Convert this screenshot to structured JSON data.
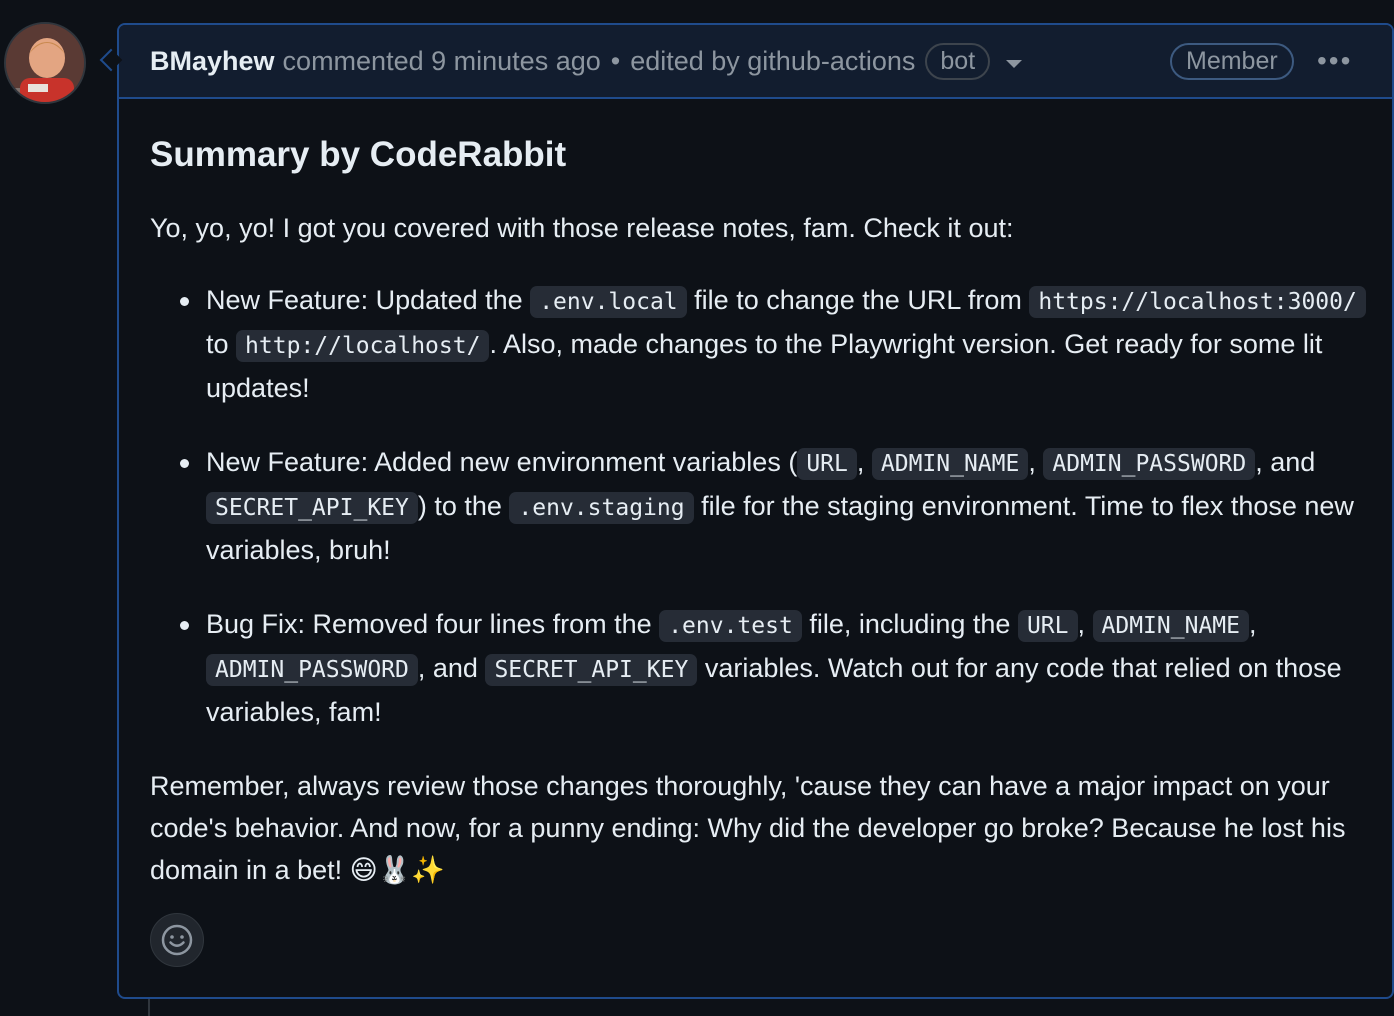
{
  "comment": {
    "author": "BMayhew",
    "action": "commented",
    "time": "9 minutes ago",
    "separator": "•",
    "edited": "edited by github-actions",
    "bot_badge": "bot",
    "member_badge": "Member",
    "more": "•••"
  },
  "body": {
    "title": "Summary by CodeRabbit",
    "intro": "Yo, yo, yo! I got you covered with those release notes, fam. Check it out:",
    "b1": {
      "t1": "New Feature: Updated the ",
      "c1": ".env.local",
      "t2": " file to change the URL from ",
      "c2": "https://localhost:3000/",
      "t3": " to ",
      "c3": "http://localhost/",
      "t4": ". Also, made changes to the Playwright version. Get ready for some lit updates!"
    },
    "b2": {
      "t1": "New Feature: Added new environment variables (",
      "c1": "URL",
      "t2": ", ",
      "c2": "ADMIN_NAME",
      "t3": ", ",
      "c3": "ADMIN_PASSWORD",
      "t4": ", and ",
      "c4": "SECRET_API_KEY",
      "t5": ") to the ",
      "c5": ".env.staging",
      "t6": " file for the staging environment. Time to flex those new variables, bruh!"
    },
    "b3": {
      "t1": "Bug Fix: Removed four lines from the ",
      "c1": ".env.test",
      "t2": " file, including the ",
      "c2": "URL",
      "t3": ", ",
      "c3": "ADMIN_NAME",
      "t4": ", ",
      "c4": "ADMIN_PASSWORD",
      "t5": ", and ",
      "c5": "SECRET_API_KEY",
      "t6": " variables. Watch out for any code that relied on those variables, fam!"
    },
    "outro": "Remember, always review those changes thoroughly, 'cause they can have a major impact on your code's behavior. And now, for a punny ending: Why did the developer go broke? Because he lost his domain in a bet! 😄🐰✨"
  }
}
